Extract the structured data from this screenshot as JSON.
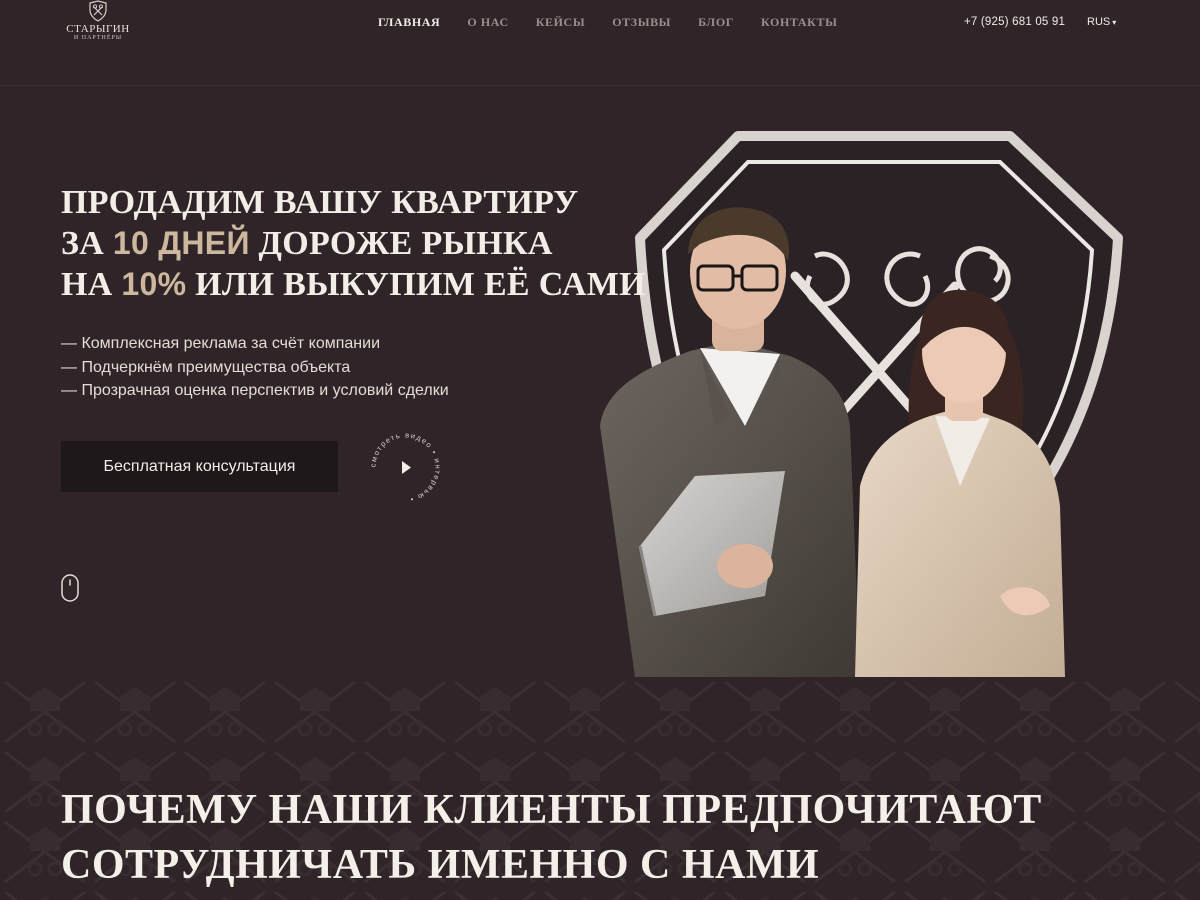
{
  "logo": {
    "name": "СТАРЫГИН",
    "subtitle": "И ПАРТНЁРЫ",
    "icon": "shield-keys-icon"
  },
  "nav": {
    "items": [
      {
        "label": "ГЛАВНАЯ",
        "active": true
      },
      {
        "label": "О НАС",
        "active": false
      },
      {
        "label": "КЕЙСЫ",
        "active": false
      },
      {
        "label": "ОТЗЫВЫ",
        "active": false
      },
      {
        "label": "БЛОГ",
        "active": false
      },
      {
        "label": "КОНТАКТЫ",
        "active": false
      }
    ]
  },
  "header": {
    "phone": "+7 (925) 681 05 91",
    "language": "RUS"
  },
  "hero": {
    "headline": {
      "line1": "ПРОДАДИМ ВАШУ КВАРТИРУ",
      "line2_prefix": "ЗА ",
      "line2_accent": "10 ДНЕЙ",
      "line2_suffix": " ДОРОЖЕ РЫНКА",
      "line3_prefix": "НА ",
      "line3_accent": "10%",
      "line3_suffix": " ИЛИ ВЫКУПИМ ЕЁ САМИ"
    },
    "features": [
      "— Комплексная реклама за счёт компании",
      "— Подчеркнём преимущества объекта",
      "— Прозрачная оценка перспектив и условий сделки"
    ],
    "cta_label": "Бесплатная консультация",
    "play_badge_text": "смотреть видео • интервью •",
    "play_icon": "play-icon",
    "scroll_icon": "mouse-scroll-icon"
  },
  "section": {
    "title_line1": "ПОЧЕМУ НАШИ КЛИЕНТЫ ПРЕДПОЧИТАЮТ",
    "title_line2": "СОТРУДНИЧАТЬ ИМЕННО С НАМИ"
  },
  "colors": {
    "background": "#2f2529",
    "accent": "#cdb79e",
    "button_bg": "#1f181b",
    "text": "#f3ede7"
  }
}
